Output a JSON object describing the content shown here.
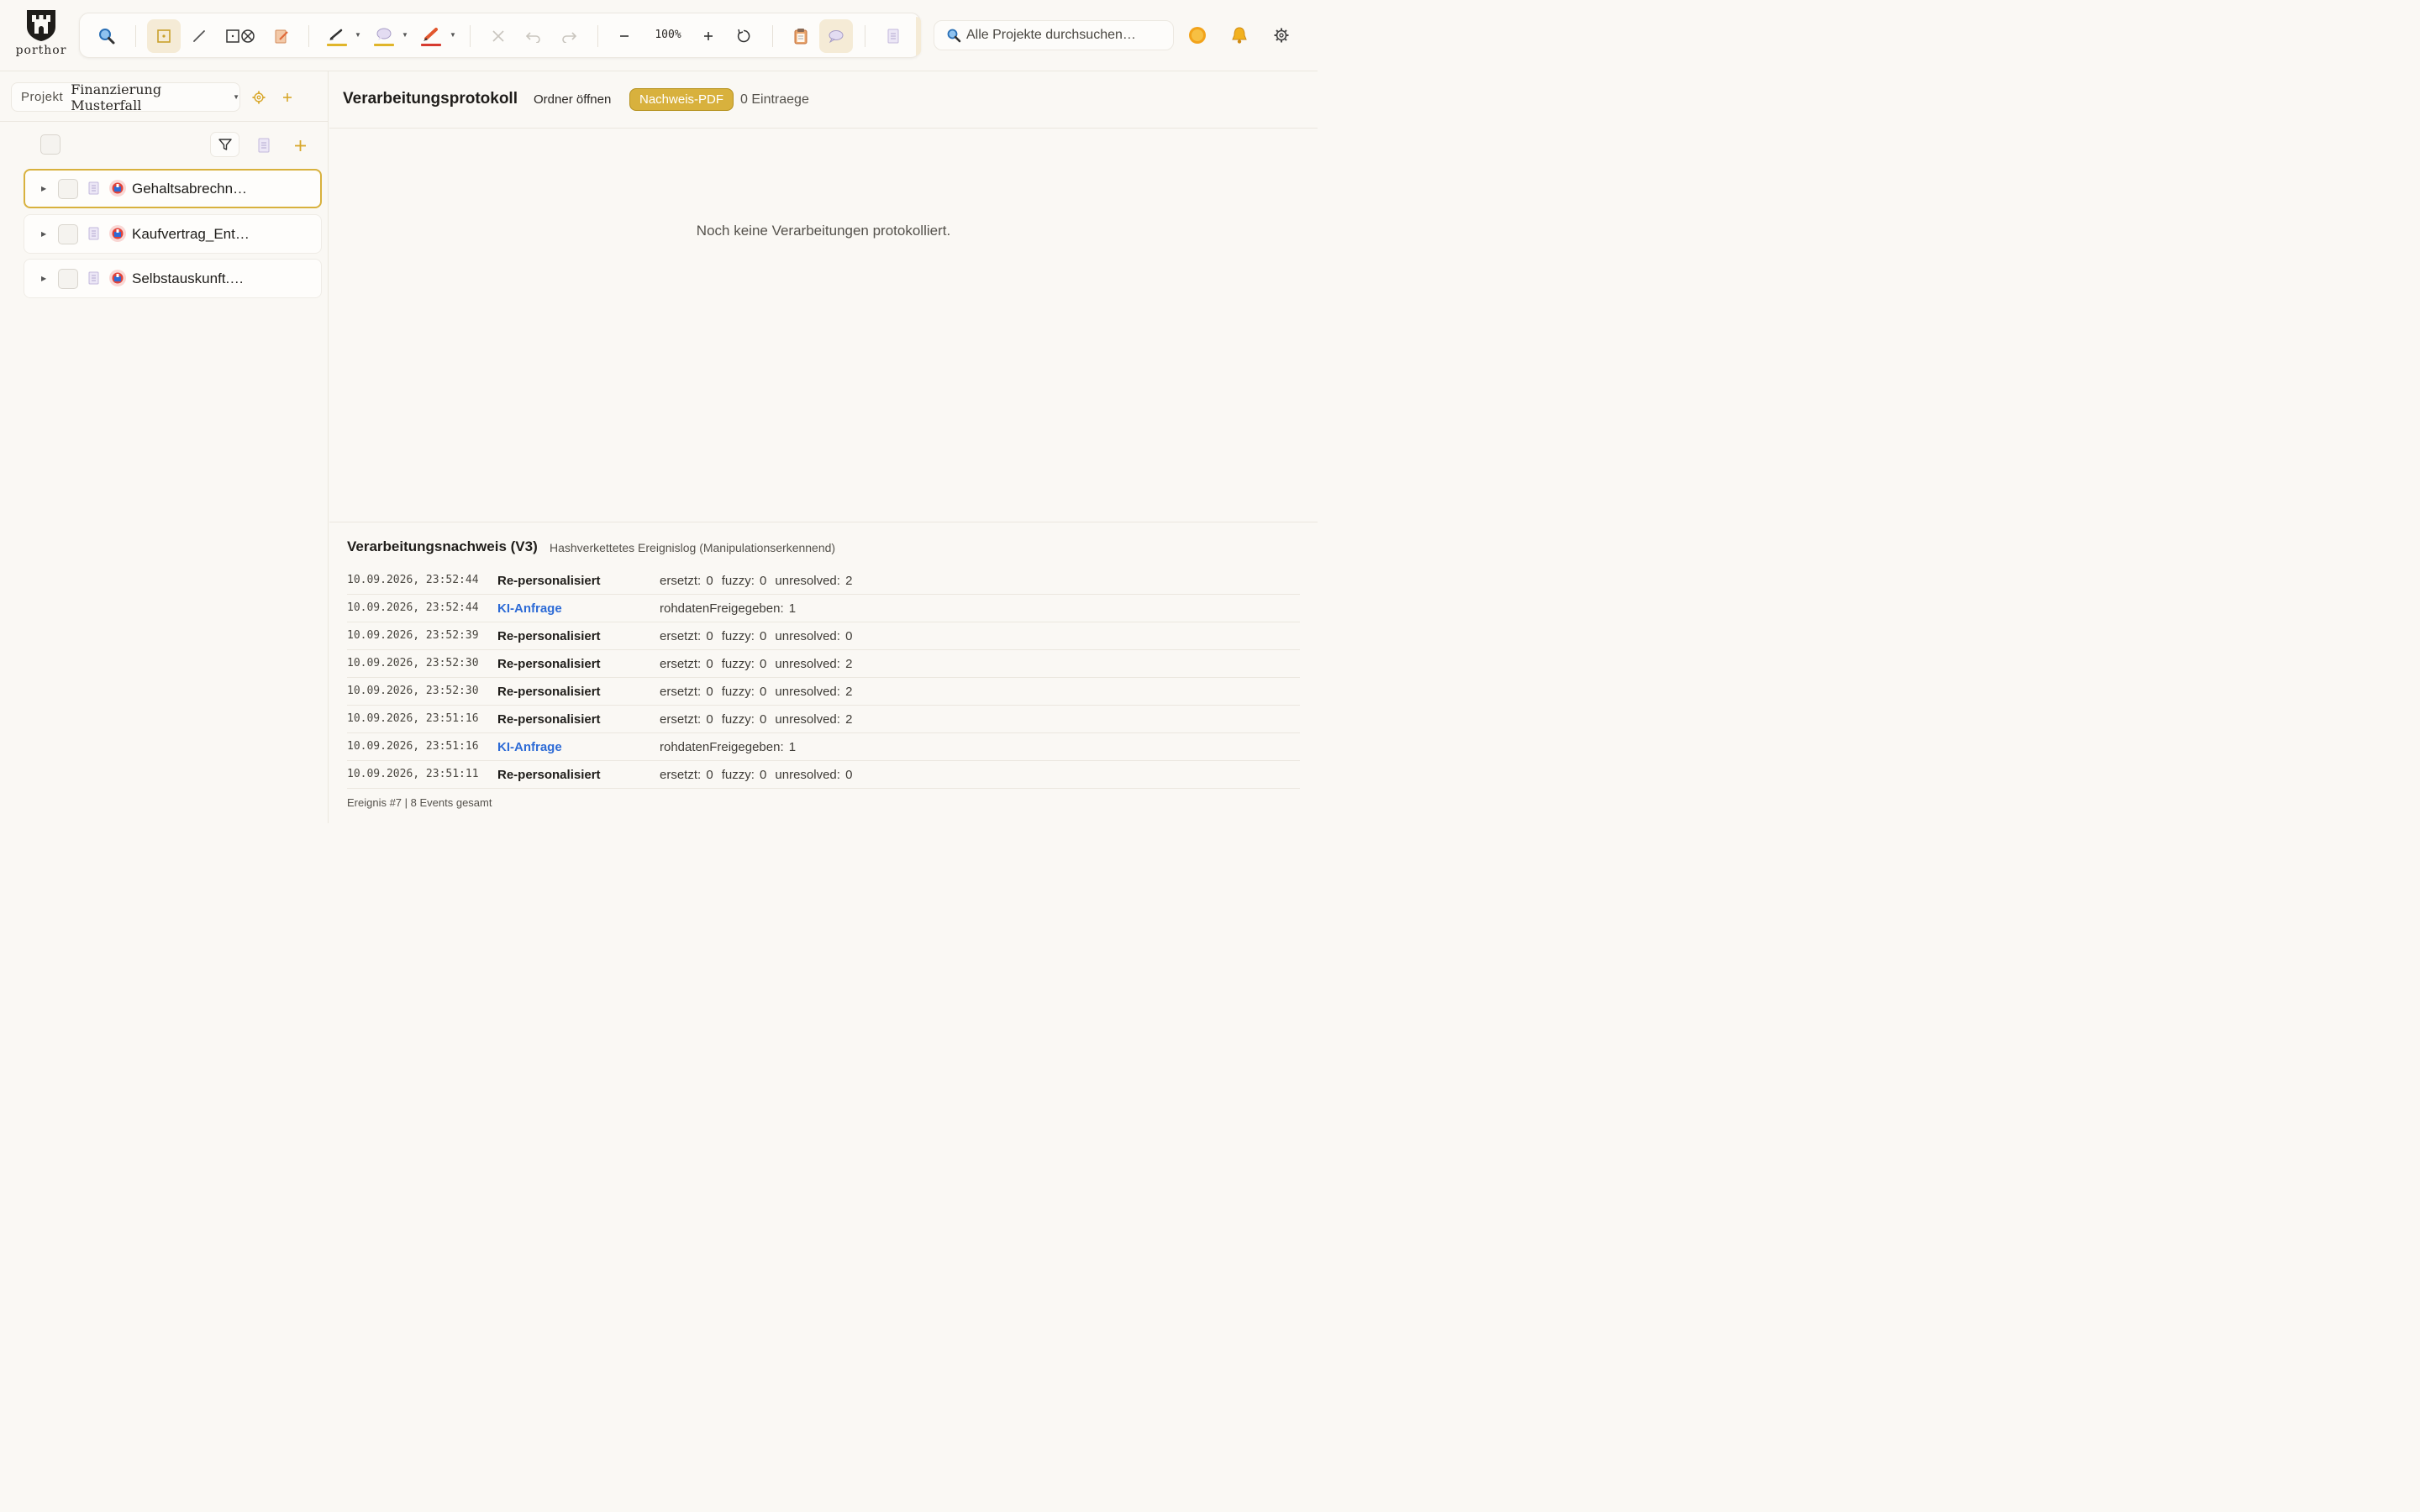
{
  "brand": {
    "name": "porthor"
  },
  "toolbar": {
    "zoom": "100%",
    "colors": {
      "highlight": "#e0b52a",
      "comment": "#e0b52a",
      "pen": "#d63a2f",
      "accent": "#d8b13d"
    }
  },
  "search": {
    "placeholder": "Alle Projekte durchsuchen…"
  },
  "project": {
    "label": "Projekt",
    "name": "Finanzierung Musterfall"
  },
  "documents": [
    {
      "name": "Gehaltsabrechn…",
      "selected": true
    },
    {
      "name": "Kaufvertrag_Ent…",
      "selected": false
    },
    {
      "name": "Selbstauskunft.…",
      "selected": false
    }
  ],
  "main": {
    "title": "Verarbeitungsprotokoll",
    "open_folder": "Ordner öffnen",
    "pdf_button": "Nachweis-PDF",
    "entry_count": "0 Eintraege",
    "empty_message": "Noch keine Verarbeitungen protokolliert."
  },
  "proof": {
    "title": "Verarbeitungsnachweis (V3)",
    "subtitle": "Hashverkettetes Ereignislog (Manipulationserkennend)",
    "events": [
      {
        "time": "10.09.2026, 23:52:44",
        "event": "Re-personalisiert",
        "link": false,
        "meta": [
          "ersetzt: 0",
          "fuzzy: 0",
          "unresolved: 2"
        ]
      },
      {
        "time": "10.09.2026, 23:52:44",
        "event": "KI-Anfrage",
        "link": true,
        "meta": [
          "rohdatenFreigegeben: 1"
        ]
      },
      {
        "time": "10.09.2026, 23:52:39",
        "event": "Re-personalisiert",
        "link": false,
        "meta": [
          "ersetzt: 0",
          "fuzzy: 0",
          "unresolved: 0"
        ]
      },
      {
        "time": "10.09.2026, 23:52:30",
        "event": "Re-personalisiert",
        "link": false,
        "meta": [
          "ersetzt: 0",
          "fuzzy: 0",
          "unresolved: 2"
        ]
      },
      {
        "time": "10.09.2026, 23:52:30",
        "event": "Re-personalisiert",
        "link": false,
        "meta": [
          "ersetzt: 0",
          "fuzzy: 0",
          "unresolved: 2"
        ]
      },
      {
        "time": "10.09.2026, 23:51:16",
        "event": "Re-personalisiert",
        "link": false,
        "meta": [
          "ersetzt: 0",
          "fuzzy: 0",
          "unresolved: 2"
        ]
      },
      {
        "time": "10.09.2026, 23:51:16",
        "event": "KI-Anfrage",
        "link": true,
        "meta": [
          "rohdatenFreigegeben: 1"
        ]
      },
      {
        "time": "10.09.2026, 23:51:11",
        "event": "Re-personalisiert",
        "link": false,
        "meta": [
          "ersetzt: 0",
          "fuzzy: 0",
          "unresolved: 0"
        ]
      }
    ],
    "footer": "Ereignis #7 | 8 Events gesamt"
  }
}
